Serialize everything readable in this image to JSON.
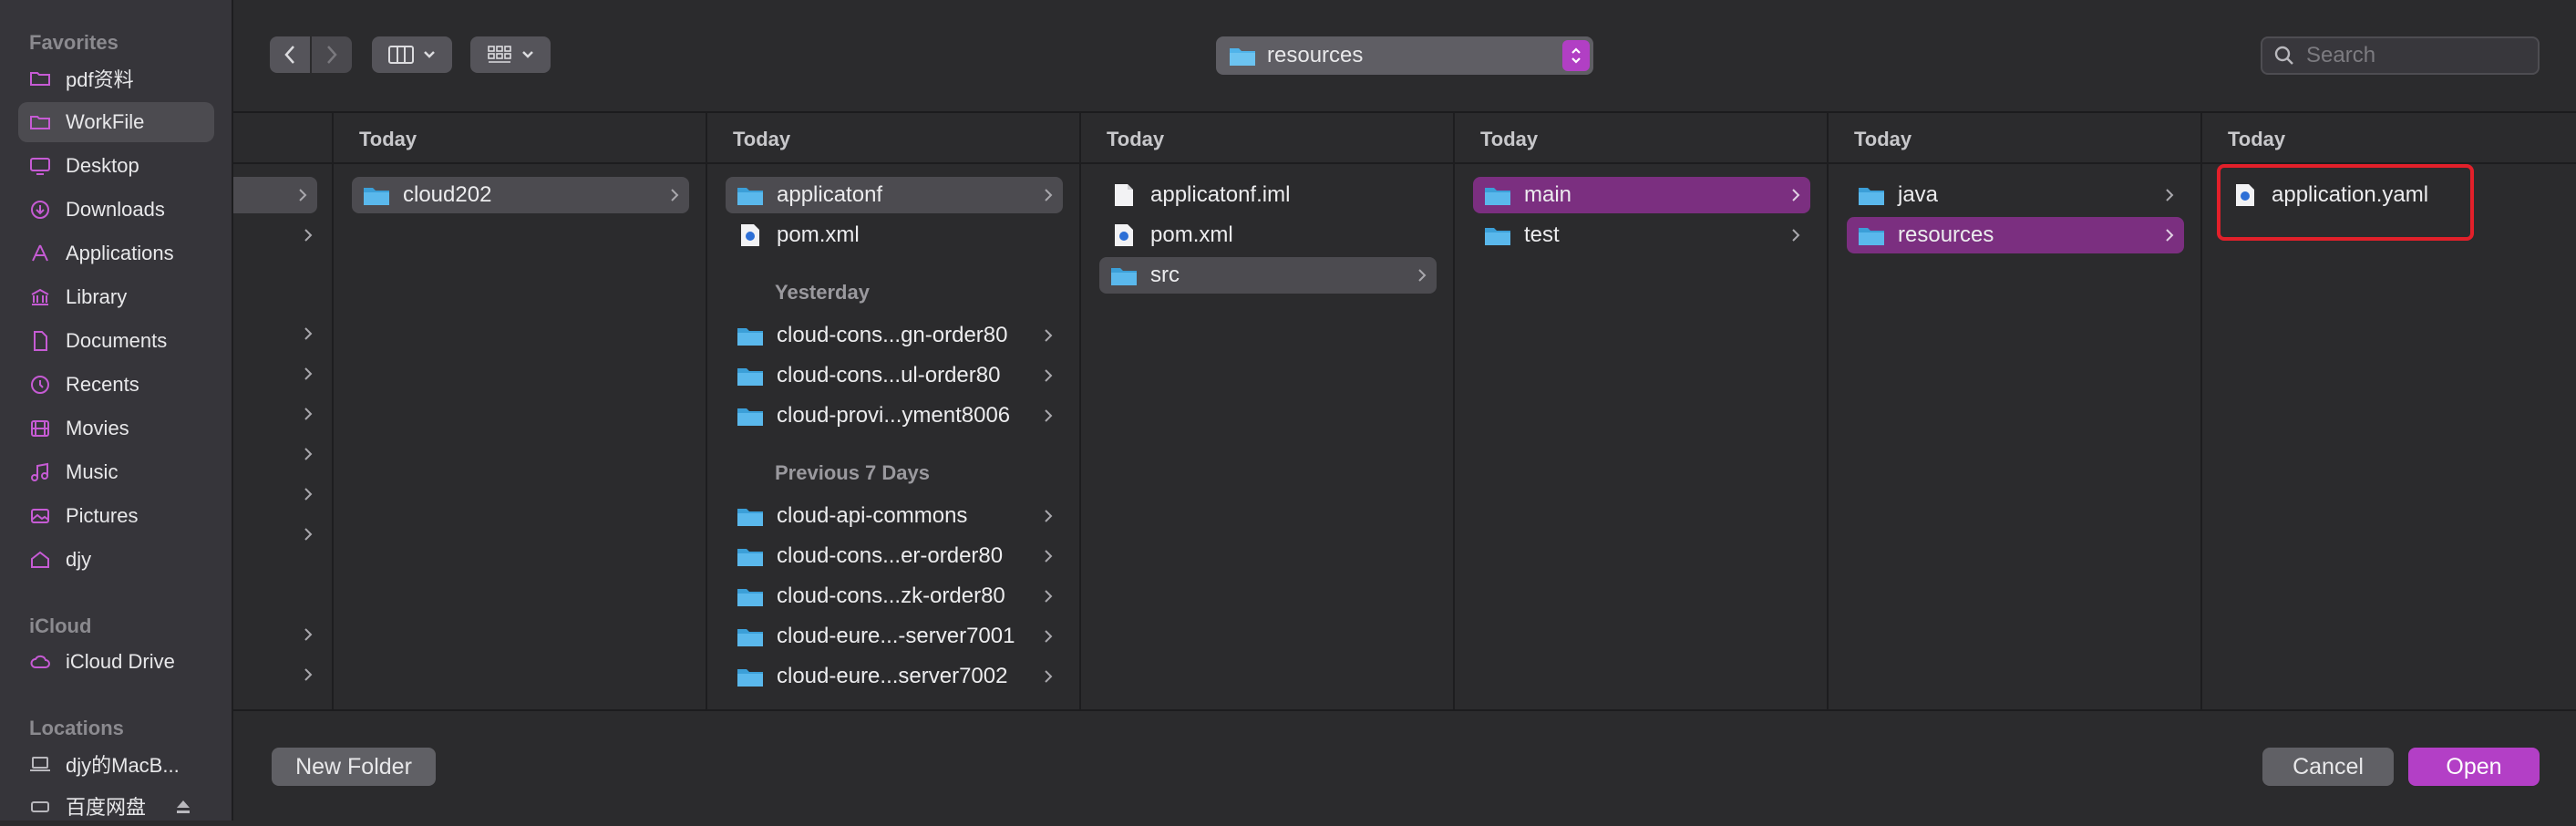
{
  "sidebar": {
    "favorites_label": "Favorites",
    "favorites": [
      {
        "label": "pdf资料",
        "icon": "folder-icon"
      },
      {
        "label": "WorkFile",
        "icon": "folder-icon",
        "selected": true
      },
      {
        "label": "Desktop",
        "icon": "desktop-icon"
      },
      {
        "label": "Downloads",
        "icon": "downloads-icon"
      },
      {
        "label": "Applications",
        "icon": "applications-icon"
      },
      {
        "label": "Library",
        "icon": "library-icon"
      },
      {
        "label": "Documents",
        "icon": "documents-icon"
      },
      {
        "label": "Recents",
        "icon": "recents-icon"
      },
      {
        "label": "Movies",
        "icon": "movies-icon"
      },
      {
        "label": "Music",
        "icon": "music-icon"
      },
      {
        "label": "Pictures",
        "icon": "pictures-icon"
      },
      {
        "label": "djy",
        "icon": "home-icon"
      }
    ],
    "icloud_label": "iCloud",
    "icloud": [
      {
        "label": "iCloud Drive",
        "icon": "cloud-icon"
      }
    ],
    "locations_label": "Locations",
    "locations": [
      {
        "label": "djy的MacB...",
        "icon": "laptop-icon"
      },
      {
        "label": "百度网盘",
        "icon": "disk-icon"
      }
    ]
  },
  "toolbar": {
    "path_label": "resources",
    "search_placeholder": "Search"
  },
  "columns": [
    {
      "header": "Today",
      "rows": [
        {
          "label": "cloud202",
          "type": "folder",
          "selected": "grey"
        }
      ]
    },
    {
      "header": "Today",
      "rows": [
        {
          "label": "applicatonf",
          "type": "folder",
          "selected": "grey"
        },
        {
          "label": "pom.xml",
          "type": "file"
        }
      ],
      "group2": "Yesterday",
      "rows2": [
        {
          "label": "cloud-cons...gn-order80",
          "type": "folder"
        },
        {
          "label": "cloud-cons...ul-order80",
          "type": "folder"
        },
        {
          "label": "cloud-provi...yment8006",
          "type": "folder"
        }
      ],
      "group3": "Previous 7 Days",
      "rows3": [
        {
          "label": "cloud-api-commons",
          "type": "folder"
        },
        {
          "label": "cloud-cons...er-order80",
          "type": "folder"
        },
        {
          "label": "cloud-cons...zk-order80",
          "type": "folder"
        },
        {
          "label": "cloud-eure...-server7001",
          "type": "folder"
        },
        {
          "label": "cloud-eure...server7002",
          "type": "folder"
        }
      ]
    },
    {
      "header": "Today",
      "rows": [
        {
          "label": "applicatonf.iml",
          "type": "doc"
        },
        {
          "label": "pom.xml",
          "type": "file"
        },
        {
          "label": "src",
          "type": "folder",
          "selected": "grey"
        }
      ]
    },
    {
      "header": "Today",
      "rows": [
        {
          "label": "main",
          "type": "folder",
          "selected": "purple"
        },
        {
          "label": "test",
          "type": "folder"
        }
      ]
    },
    {
      "header": "Today",
      "rows": [
        {
          "label": "java",
          "type": "folder"
        },
        {
          "label": "resources",
          "type": "folder",
          "selected": "purple"
        }
      ]
    },
    {
      "header": "Today",
      "rows": [
        {
          "label": "application.yaml",
          "type": "file"
        }
      ]
    }
  ],
  "buttons": {
    "new_folder": "New Folder",
    "cancel": "Cancel",
    "open": "Open"
  },
  "colors": {
    "accent": "#b33fc6",
    "selection_purple": "#7b2f80",
    "highlight_box": "#e2202a",
    "folder_blue": "#4fb3ea"
  }
}
